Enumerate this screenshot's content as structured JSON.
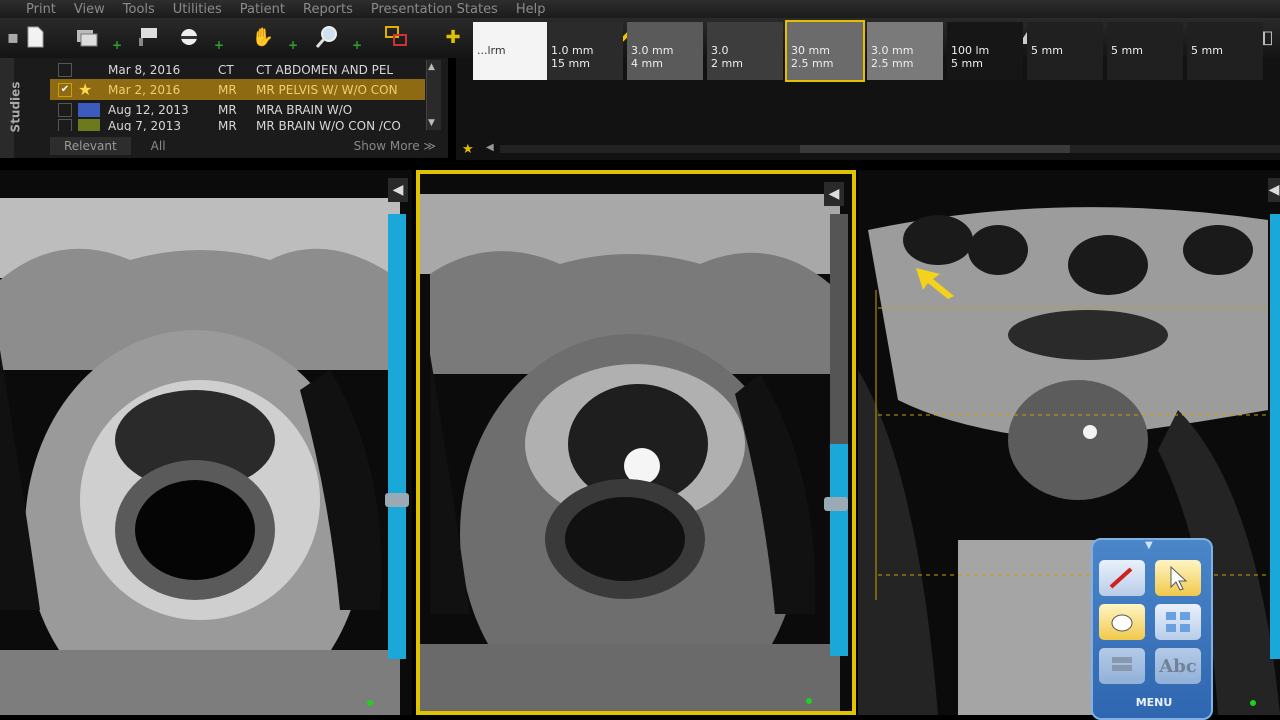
{
  "menu": [
    "Print",
    "View",
    "Tools",
    "Utilities",
    "Patient",
    "Reports",
    "Presentation States",
    "Help"
  ],
  "studies": {
    "tab_label": "Studies",
    "rows": [
      {
        "date": "Mar 8, 2016",
        "modality": "CT",
        "desc": "CT ABDOMEN AND PEL",
        "color": "#1b1b1b"
      },
      {
        "date": "Mar 2, 2016",
        "modality": "MR",
        "desc": "MR PELVIS W/ W/O CON",
        "color": "#8e6a12"
      },
      {
        "date": "Aug 12, 2013",
        "modality": "MR",
        "desc": "MRA BRAIN W/O",
        "color": "#3c5bbd"
      },
      {
        "date": "Aug 7, 2013",
        "modality": "MR",
        "desc": "MR BRAIN W/O CON /CO",
        "color": "#6b7a1a"
      }
    ],
    "footer": {
      "relevant": "Relevant",
      "all": "All",
      "show_more": "Show More ≫"
    }
  },
  "thumbnails": [
    {
      "label": "...lrm"
    },
    {
      "label": "1.0 mm\n15 mm"
    },
    {
      "label": "3.0 mm\n4 mm"
    },
    {
      "label": "3.0\n2 mm"
    },
    {
      "label": "30 mm\n2.5 mm"
    },
    {
      "label": "3.0 mm\n2.5 mm"
    },
    {
      "label": "100 lm\n5 mm"
    },
    {
      "label": "5 mm"
    },
    {
      "label": "5 mm"
    },
    {
      "label": "5 mm"
    }
  ],
  "palette": {
    "menu_label": "MENU",
    "text_tool": "Abc"
  },
  "colors": {
    "accent_yellow": "#e0c300",
    "scroll_blue": "#1aa8d8",
    "status_green": "#1fd11f"
  }
}
